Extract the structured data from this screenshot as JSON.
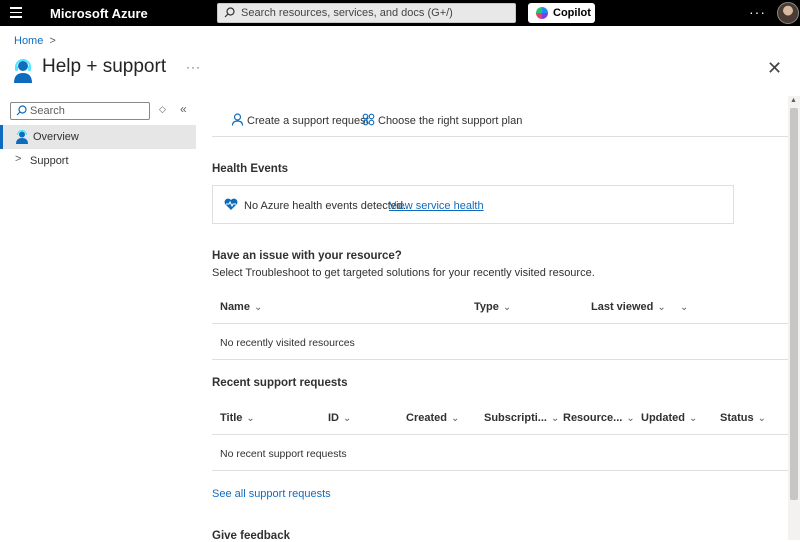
{
  "topbar": {
    "menu_icon": "hamburger-menu-icon",
    "brand": "Microsoft Azure",
    "search_placeholder": "Search resources, services, and docs (G+/)",
    "copilot_label": "Copilot",
    "more_label": "···"
  },
  "breadcrumb": {
    "home": "Home",
    "separator": ">"
  },
  "header": {
    "title": "Help + support",
    "more": "···",
    "close": "✕"
  },
  "sidebar": {
    "search_placeholder": "Search",
    "items": [
      {
        "label": "Overview",
        "icon": "support-agent-icon",
        "active": true
      },
      {
        "label": "Support",
        "icon": "chevron-right-icon",
        "active": false
      }
    ]
  },
  "commands": {
    "create": "Create a support request",
    "plan": "Choose the right support plan"
  },
  "health": {
    "title": "Health Events",
    "message": "No Azure health events detected.",
    "link": "View service health"
  },
  "issue": {
    "title": "Have an issue with your resource?",
    "subtitle": "Select Troubleshoot to get targeted solutions for your recently visited resource.",
    "columns": [
      "Name",
      "Type",
      "Last viewed"
    ],
    "empty": "No recently visited resources"
  },
  "recent": {
    "title": "Recent support requests",
    "columns": [
      "Title",
      "ID",
      "Created",
      "Subscripti...",
      "Resource...",
      "Updated",
      "Status"
    ],
    "empty": "No recent support requests",
    "see_all": "See all support requests"
  },
  "feedback": {
    "title": "Give feedback"
  },
  "colors": {
    "accent": "#0f6cbd",
    "topbar": "#000000",
    "health_heart": "#0f6cbd"
  }
}
